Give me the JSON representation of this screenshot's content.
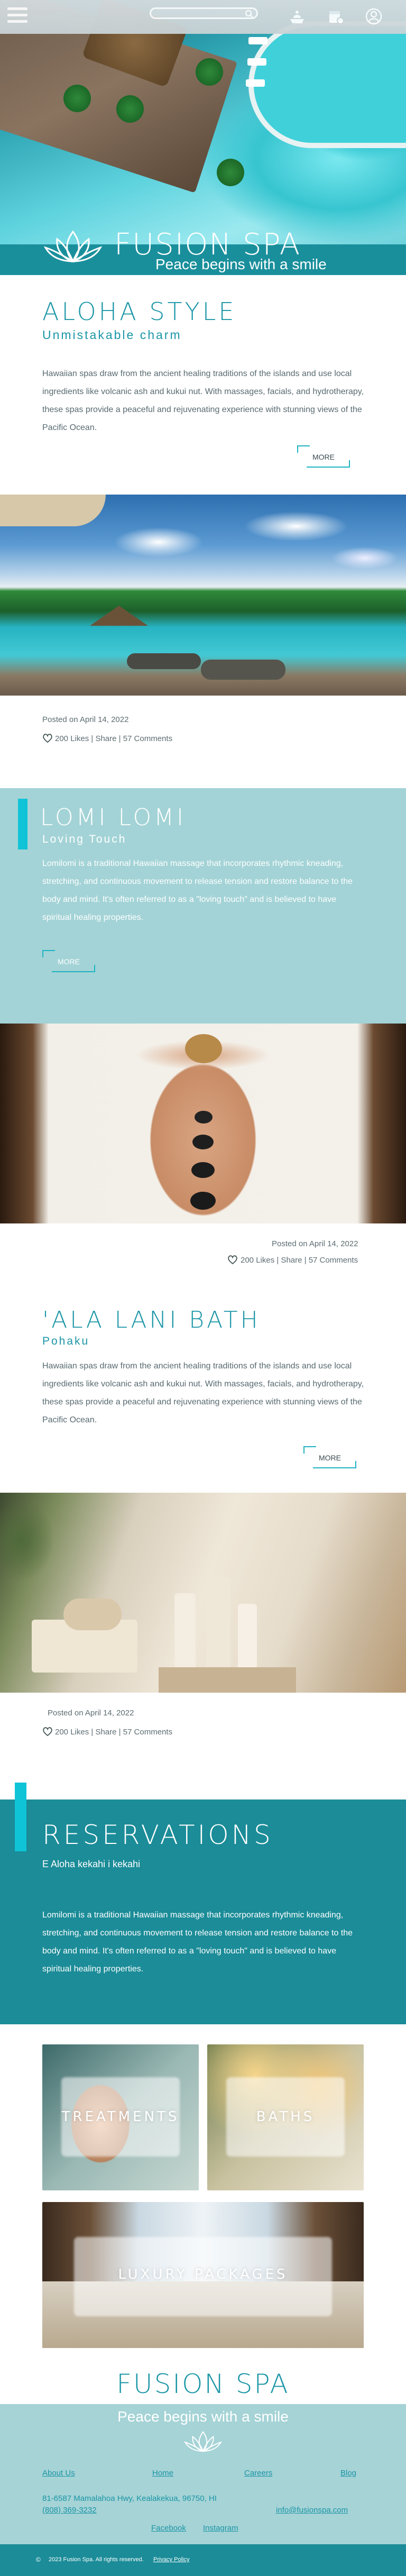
{
  "header": {
    "menu_icon": "hamburger-icon",
    "search_placeholder": "",
    "icons": [
      "spa-bowl-icon",
      "calendar-icon",
      "account-icon"
    ]
  },
  "hero": {
    "brand": "FUSION SPA",
    "tagline": "Peace begins with a smile"
  },
  "aloha": {
    "title": "ALOHA STYLE",
    "subtitle": "Unmistakable charm",
    "body": "Hawaiian spas draw from the ancient healing traditions of the islands and use local ingredients like volcanic ash and kukui nut. With massages, facials, and hydrotherapy, these spas provide a peaceful and rejuvenating experience with stunning views of the Pacific Ocean.",
    "more": "MORE"
  },
  "post1": {
    "posted": "Posted on April 14, 2022",
    "stats": "200 Likes | Share | 57 Comments"
  },
  "lomi": {
    "title": "LOMI LOMI",
    "subtitle": "Loving Touch",
    "body": "Lomilomi is a traditional Hawaiian massage that incorporates rhythmic kneading, stretching, and continuous movement to release tension and restore balance to the body and mind. It's often referred to as a \"loving touch\" and is believed to have spiritual healing properties.",
    "more": "MORE"
  },
  "post2": {
    "posted": "Posted on April 14, 2022",
    "stats": "200 Likes | Share | 57 Comments"
  },
  "bath": {
    "title": "'ALA LANI BATH",
    "subtitle": "Pohaku",
    "body": "Hawaiian spas draw from the ancient healing traditions of the islands and use local ingredients like volcanic ash and kukui nut. With massages, facials, and hydrotherapy, these spas provide a peaceful and rejuvenating experience with stunning views of the Pacific Ocean.",
    "more": "MORE"
  },
  "post3": {
    "posted": "Posted on April 14, 2022",
    "stats": "200 Likes | Share | 57 Comments"
  },
  "reservations": {
    "title": "RESERVATIONS",
    "subtitle": "E Aloha kekahi i kekahi",
    "body": "Lomilomi is a traditional Hawaiian massage that incorporates rhythmic kneading, stretching, and continuous movement to release tension and restore balance to the body and mind. It's often referred to as a \"loving touch\" and is believed to have spiritual healing properties."
  },
  "tiles": {
    "treatments": "TREATMENTS",
    "baths": "BATHS",
    "packages": "LUXURY PACKAGES"
  },
  "footer": {
    "brand": "FUSION SPA",
    "tagline": "Peace begins with a smile",
    "links": [
      "About Us",
      "Home",
      "Careers",
      "Blog"
    ],
    "address": "81-6587 Mamalahoa Hwy, Kealakekua, 96750, HI",
    "phone": "(808) 369-3232",
    "email": "info@fusionspa.com",
    "social": [
      "Facebook",
      "Instagram"
    ],
    "copyright": "2023 Fusion Spa. All rights reserved.",
    "privacy": "Privacy Policy"
  },
  "colors": {
    "teal": "#1b8c98",
    "light_teal": "#a3d3d6",
    "accent": "#0fc4d6"
  }
}
